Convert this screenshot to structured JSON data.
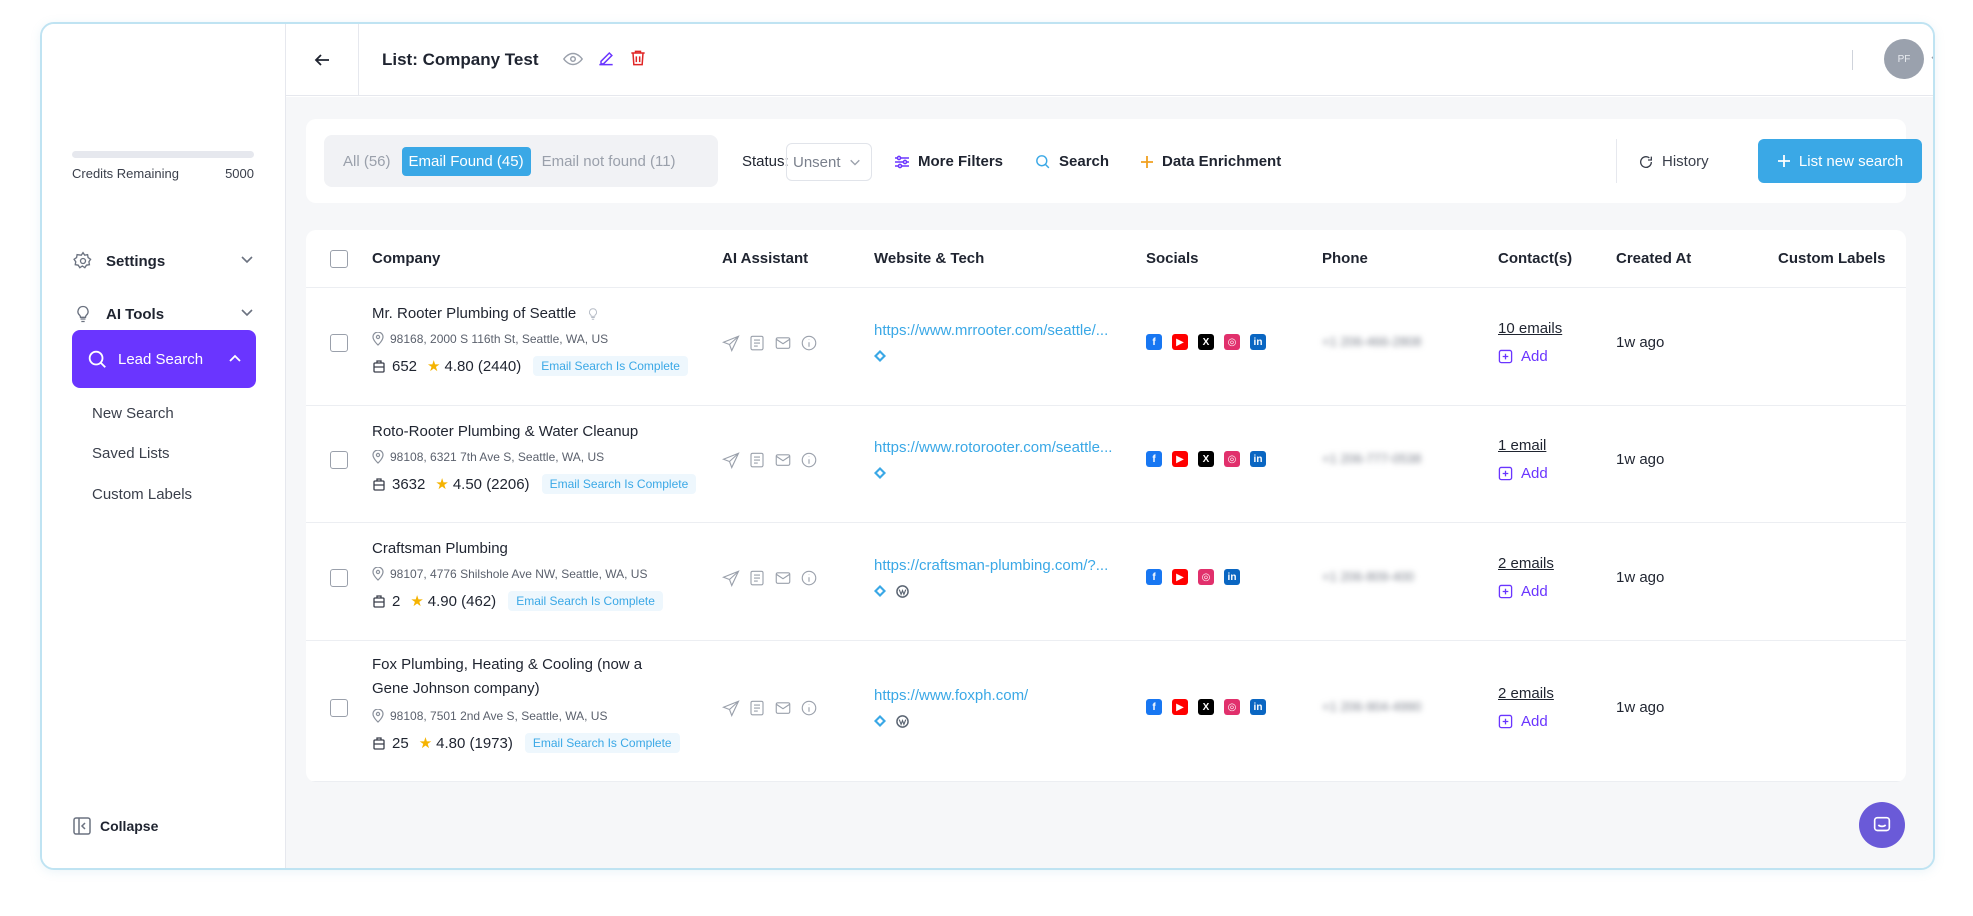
{
  "sidebar": {
    "credits_label": "Credits Remaining",
    "credits_value": "5000",
    "credits_used_fraction": 0,
    "settings_label": "Settings",
    "ai_tools_label": "AI Tools",
    "lead_search_label": "Lead Search",
    "sub_items": [
      "New Search",
      "Saved Lists",
      "Custom Labels"
    ],
    "collapse_label": "Collapse"
  },
  "header": {
    "title": "List: Company Test",
    "avatar_initials": "PF"
  },
  "filters": {
    "tabs": [
      "All (56)",
      "Email Found (45)",
      "Email not found (11)"
    ],
    "active_tab": 1,
    "status_label": "Status:",
    "status_value": "Unsent",
    "more_filters": "More Filters",
    "search": "Search",
    "data_enrichment": "Data Enrichment",
    "history": "History",
    "new_search": "List new search"
  },
  "table": {
    "columns": [
      "Company",
      "AI Assistant",
      "Website & Tech",
      "Socials",
      "Phone",
      "Contact(s)",
      "Created At",
      "Custom Labels"
    ],
    "rows": [
      {
        "name": "Mr. Rooter Plumbing of Seattle",
        "address": "98168, 2000 S 116th St, Seattle, WA, US",
        "employees": "652",
        "rating": "4.80 (2440)",
        "badge": "Email Search Is Complete",
        "url": "https://www.mrrooter.com/seattle/...",
        "tech": [
          "diamond"
        ],
        "socials": [
          "facebook",
          "youtube",
          "x",
          "instagram",
          "linkedin"
        ],
        "phone": "+1 206-466-2808",
        "emails": "10 emails",
        "add": "Add",
        "created": "1w ago"
      },
      {
        "name": "Roto-Rooter Plumbing & Water Cleanup",
        "address": "98108, 6321 7th Ave S, Seattle, WA, US",
        "employees": "3632",
        "rating": "4.50 (2206)",
        "badge": "Email Search Is Complete",
        "url": "https://www.rotorooter.com/seattle...",
        "tech": [
          "diamond"
        ],
        "socials": [
          "facebook",
          "youtube",
          "x",
          "instagram",
          "linkedin"
        ],
        "phone": "+1 206-777-0538",
        "emails": "1 email",
        "add": "Add",
        "created": "1w ago"
      },
      {
        "name": "Craftsman Plumbing",
        "address": "98107, 4776 Shilshole Ave NW, Seattle, WA, US",
        "employees": "2",
        "rating": "4.90 (462)",
        "badge": "Email Search Is Complete",
        "url": "https://craftsman-plumbing.com/?...",
        "tech": [
          "diamond",
          "wordpress"
        ],
        "socials": [
          "facebook",
          "youtube",
          "instagram",
          "linkedin"
        ],
        "phone": "+1 206-809-400",
        "emails": "2 emails",
        "add": "Add",
        "created": "1w ago"
      },
      {
        "name": "Fox Plumbing, Heating & Cooling (now a Gene Johnson company)",
        "address": "98108, 7501 2nd Ave S, Seattle, WA, US",
        "employees": "25",
        "rating": "4.80 (1973)",
        "badge": "Email Search Is Complete",
        "url": "https://www.foxph.com/",
        "tech": [
          "diamond",
          "wordpress"
        ],
        "socials": [
          "facebook",
          "youtube",
          "x",
          "instagram",
          "linkedin"
        ],
        "phone": "+1 206-904-4990",
        "emails": "2 emails",
        "add": "Add",
        "created": "1w ago"
      }
    ]
  },
  "colors": {
    "accent_purple": "#6a35ff",
    "accent_blue": "#3aa8e6",
    "facebook": "#1877f2",
    "youtube": "#ff0000",
    "x": "#000000",
    "instagram": "#e1306c",
    "linkedin": "#0a66c2"
  }
}
